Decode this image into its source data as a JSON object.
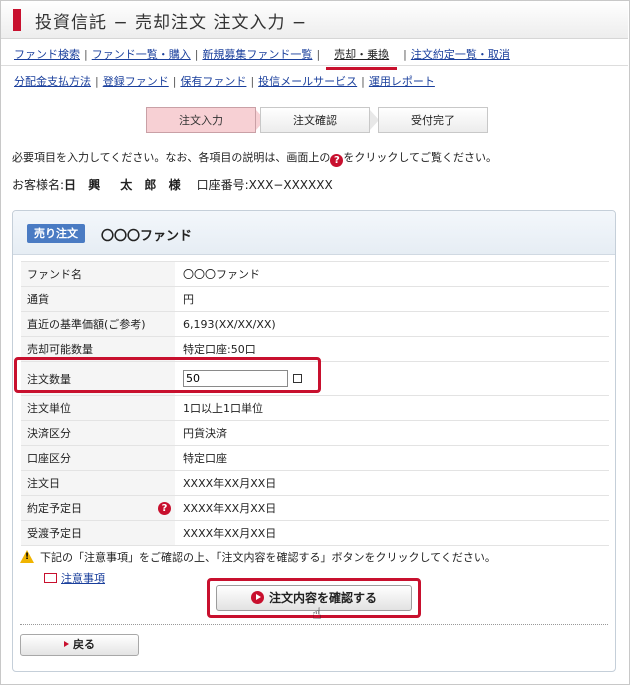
{
  "title": "投資信託 − 売却注文 注文入力 −",
  "nav": {
    "row1": [
      "ファンド検索",
      "ファンド一覧・購入",
      "新規募集ファンド一覧",
      "売却・乗換",
      "注文約定一覧・取消"
    ],
    "row2": [
      "分配金支払方法",
      "登録ファンド",
      "保有ファンド",
      "投信メールサービス",
      "運用レポート"
    ]
  },
  "steps": [
    "注文入力",
    "注文確認",
    "受付完了"
  ],
  "instruction_pre": "必要項目を入力してください。なお、各項目の説明は、画面上の",
  "instruction_post": "をクリックしてご覧ください。",
  "help_glyph": "?",
  "customer": {
    "label": "お客様名:",
    "name": "日 興　太 郎 様",
    "account": "口座番号:XXX−XXXXXX"
  },
  "panel": {
    "badge": "売り注文",
    "fund_name": "〇〇〇ファンド"
  },
  "rows": [
    {
      "label": "ファンド名",
      "value": "〇〇〇ファンド"
    },
    {
      "label": "通貨",
      "value": "円"
    },
    {
      "label": "直近の基準価額(ご参考)",
      "value": "6,193(XX/XX/XX)"
    },
    {
      "label": "売却可能数量",
      "value": "特定口座:50口"
    },
    {
      "label": "注文数量",
      "value": "50"
    },
    {
      "label": "注文単位",
      "value": "1口以上1口単位"
    },
    {
      "label": "決済区分",
      "value": "円貨決済"
    },
    {
      "label": "口座区分",
      "value": "特定口座"
    },
    {
      "label": "注文日",
      "value": "XXXX年XX月XX日"
    },
    {
      "label": "約定予定日",
      "value": "XXXX年XX月XX日"
    },
    {
      "label": "受渡予定日",
      "value": "XXXX年XX月XX日"
    }
  ],
  "warning": "下記の「注意事項」をご確認の上、「注文内容を確認する」ボタンをクリックしてください。",
  "warning_glyph": "!",
  "notes_link": "注意事項",
  "confirm_button": "注文内容を確認する",
  "back_button": "戻る",
  "colors": {
    "accent": "#c8102e",
    "badge": "#4a7bc3",
    "link": "#1a3f9c"
  }
}
